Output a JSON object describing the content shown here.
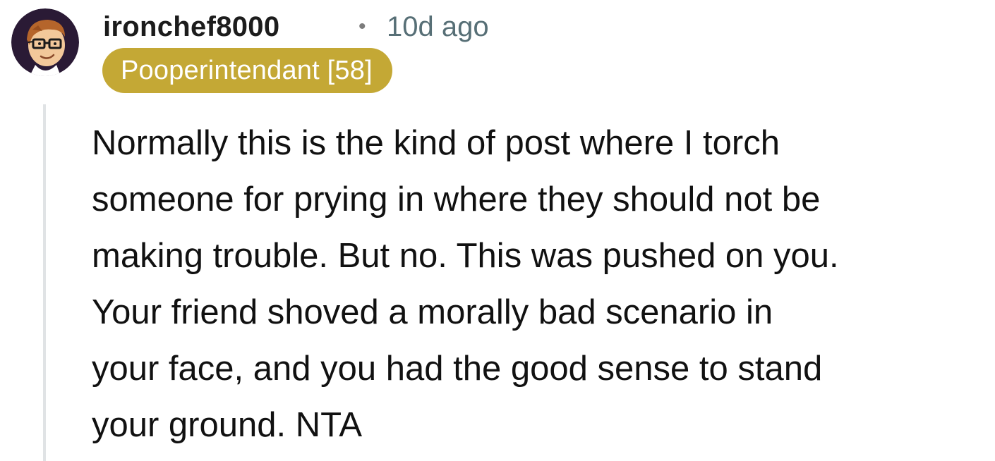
{
  "comment": {
    "author": "ironchef8000",
    "separator": "•",
    "timestamp": "10d ago",
    "avatar": "avatar-icon",
    "flair": {
      "text": "Pooperintendant [58]",
      "color": "#c4a835"
    },
    "body_lines": [
      "Normally this is the kind of post where I torch",
      "someone for prying in where they should not be",
      "making trouble. But no. This was pushed on you.",
      "Your friend shoved a morally bad scenario in",
      "your face, and you had the good sense to stand",
      "your ground. NTA"
    ]
  }
}
